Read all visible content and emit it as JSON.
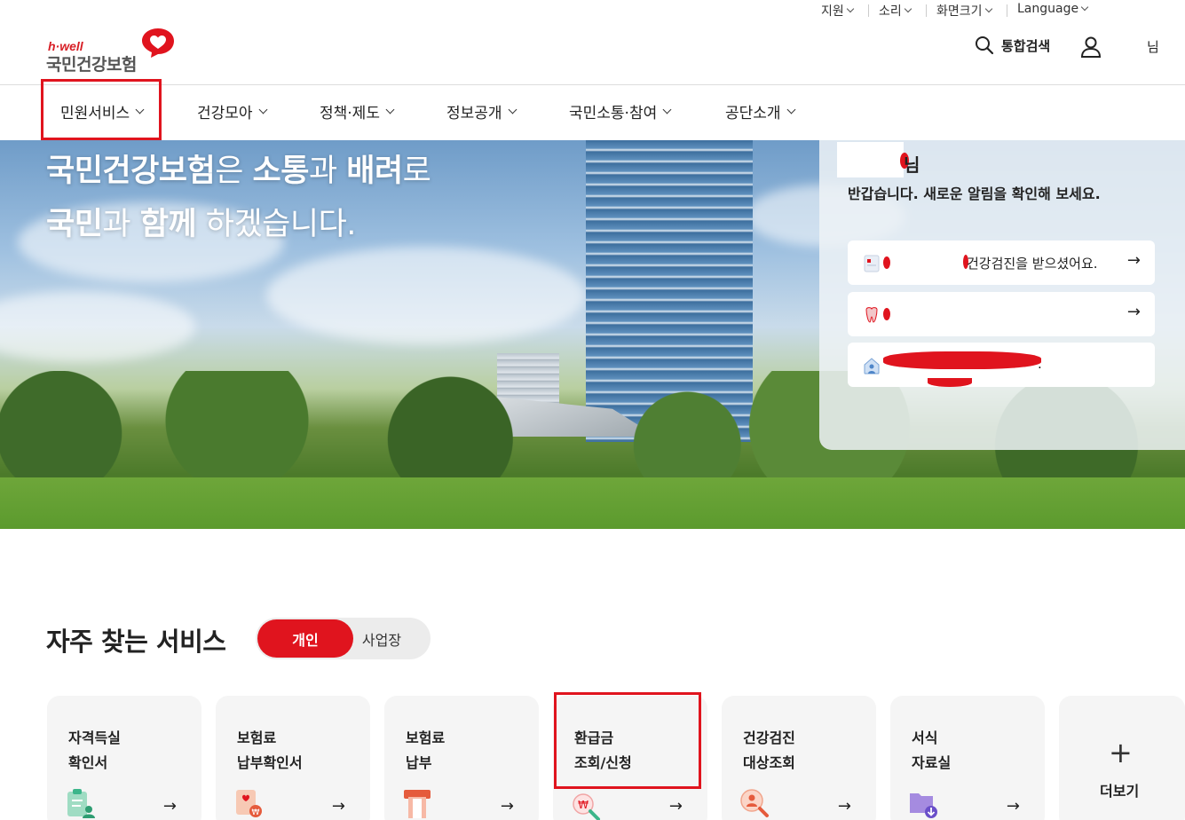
{
  "utility_bar": {
    "items": [
      {
        "label": "지원"
      },
      {
        "label": "소리"
      },
      {
        "label": "화면크기"
      },
      {
        "label": "Language"
      }
    ]
  },
  "header": {
    "logo": {
      "tagline": "h·well",
      "name": "국민건강보험"
    },
    "search_label": "통합검색",
    "user_suffix": "님"
  },
  "gnb": {
    "items": [
      {
        "label": "민원서비스",
        "selected": true
      },
      {
        "label": "건강모아"
      },
      {
        "label": "정책·제도"
      },
      {
        "label": "정보공개"
      },
      {
        "label": "국민소통·참여"
      },
      {
        "label": "공단소개"
      }
    ]
  },
  "hero": {
    "line1": [
      {
        "text": "국민건강보험",
        "bold": true
      },
      {
        "text": "은 ",
        "bold": false
      },
      {
        "text": "소통",
        "bold": true
      },
      {
        "text": "과 ",
        "bold": false
      },
      {
        "text": "배려",
        "bold": true
      },
      {
        "text": "로",
        "bold": false
      }
    ],
    "line2": [
      {
        "text": "국민",
        "bold": true
      },
      {
        "text": "과 ",
        "bold": false
      },
      {
        "text": "함께",
        "bold": true
      },
      {
        "text": " 하겠습니다.",
        "bold": false
      }
    ]
  },
  "notice_panel": {
    "name_suffix": "님",
    "greeting": "반갑습니다. 새로운 알림을 확인해 보세요.",
    "items": [
      {
        "text": "건강검진을 받으셨어요.",
        "icon": "health-checkup-icon",
        "arrow": "→"
      },
      {
        "text": "",
        "icon": "dental-icon",
        "arrow": "→"
      },
      {
        "text": ".",
        "icon": "house-person-icon",
        "arrow": ""
      }
    ]
  },
  "frequent_services": {
    "title": "자주 찾는 서비스",
    "toggle": {
      "active": "개인",
      "inactive": "사업장"
    },
    "cards": [
      {
        "line1": "자격득실",
        "line2": "확인서",
        "icon": "clipboard-person-icon",
        "arrow": "→"
      },
      {
        "line1": "보험료",
        "line2": "납부확인서",
        "icon": "document-won-icon",
        "arrow": "→"
      },
      {
        "line1": "보험료",
        "line2": "납부",
        "icon": "payment-terminal-icon",
        "arrow": "→"
      },
      {
        "line1": "환급금",
        "line2": "조회/신청",
        "icon": "magnifier-won-icon",
        "arrow": "→",
        "highlighted": true
      },
      {
        "line1": "건강검진",
        "line2": "대상조회",
        "icon": "magnifier-person-icon",
        "arrow": "→"
      },
      {
        "line1": "서식",
        "line2": "자료실",
        "icon": "folder-download-icon",
        "arrow": "→"
      }
    ],
    "more": {
      "symbol": "+",
      "label": "더보기"
    }
  },
  "colors": {
    "brand_red": "#e0141e",
    "highlight_box": "#e0141e"
  }
}
